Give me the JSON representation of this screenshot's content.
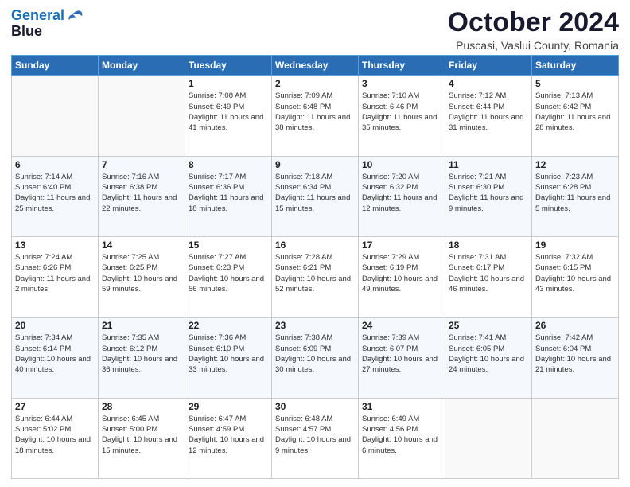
{
  "logo": {
    "line1": "General",
    "line2": "Blue"
  },
  "header": {
    "month": "October 2024",
    "location": "Puscasi, Vaslui County, Romania"
  },
  "days_of_week": [
    "Sunday",
    "Monday",
    "Tuesday",
    "Wednesday",
    "Thursday",
    "Friday",
    "Saturday"
  ],
  "weeks": [
    [
      {
        "day": "",
        "sunrise": "",
        "sunset": "",
        "daylight": ""
      },
      {
        "day": "",
        "sunrise": "",
        "sunset": "",
        "daylight": ""
      },
      {
        "day": "1",
        "sunrise": "Sunrise: 7:08 AM",
        "sunset": "Sunset: 6:49 PM",
        "daylight": "Daylight: 11 hours and 41 minutes."
      },
      {
        "day": "2",
        "sunrise": "Sunrise: 7:09 AM",
        "sunset": "Sunset: 6:48 PM",
        "daylight": "Daylight: 11 hours and 38 minutes."
      },
      {
        "day": "3",
        "sunrise": "Sunrise: 7:10 AM",
        "sunset": "Sunset: 6:46 PM",
        "daylight": "Daylight: 11 hours and 35 minutes."
      },
      {
        "day": "4",
        "sunrise": "Sunrise: 7:12 AM",
        "sunset": "Sunset: 6:44 PM",
        "daylight": "Daylight: 11 hours and 31 minutes."
      },
      {
        "day": "5",
        "sunrise": "Sunrise: 7:13 AM",
        "sunset": "Sunset: 6:42 PM",
        "daylight": "Daylight: 11 hours and 28 minutes."
      }
    ],
    [
      {
        "day": "6",
        "sunrise": "Sunrise: 7:14 AM",
        "sunset": "Sunset: 6:40 PM",
        "daylight": "Daylight: 11 hours and 25 minutes."
      },
      {
        "day": "7",
        "sunrise": "Sunrise: 7:16 AM",
        "sunset": "Sunset: 6:38 PM",
        "daylight": "Daylight: 11 hours and 22 minutes."
      },
      {
        "day": "8",
        "sunrise": "Sunrise: 7:17 AM",
        "sunset": "Sunset: 6:36 PM",
        "daylight": "Daylight: 11 hours and 18 minutes."
      },
      {
        "day": "9",
        "sunrise": "Sunrise: 7:18 AM",
        "sunset": "Sunset: 6:34 PM",
        "daylight": "Daylight: 11 hours and 15 minutes."
      },
      {
        "day": "10",
        "sunrise": "Sunrise: 7:20 AM",
        "sunset": "Sunset: 6:32 PM",
        "daylight": "Daylight: 11 hours and 12 minutes."
      },
      {
        "day": "11",
        "sunrise": "Sunrise: 7:21 AM",
        "sunset": "Sunset: 6:30 PM",
        "daylight": "Daylight: 11 hours and 9 minutes."
      },
      {
        "day": "12",
        "sunrise": "Sunrise: 7:23 AM",
        "sunset": "Sunset: 6:28 PM",
        "daylight": "Daylight: 11 hours and 5 minutes."
      }
    ],
    [
      {
        "day": "13",
        "sunrise": "Sunrise: 7:24 AM",
        "sunset": "Sunset: 6:26 PM",
        "daylight": "Daylight: 11 hours and 2 minutes."
      },
      {
        "day": "14",
        "sunrise": "Sunrise: 7:25 AM",
        "sunset": "Sunset: 6:25 PM",
        "daylight": "Daylight: 10 hours and 59 minutes."
      },
      {
        "day": "15",
        "sunrise": "Sunrise: 7:27 AM",
        "sunset": "Sunset: 6:23 PM",
        "daylight": "Daylight: 10 hours and 56 minutes."
      },
      {
        "day": "16",
        "sunrise": "Sunrise: 7:28 AM",
        "sunset": "Sunset: 6:21 PM",
        "daylight": "Daylight: 10 hours and 52 minutes."
      },
      {
        "day": "17",
        "sunrise": "Sunrise: 7:29 AM",
        "sunset": "Sunset: 6:19 PM",
        "daylight": "Daylight: 10 hours and 49 minutes."
      },
      {
        "day": "18",
        "sunrise": "Sunrise: 7:31 AM",
        "sunset": "Sunset: 6:17 PM",
        "daylight": "Daylight: 10 hours and 46 minutes."
      },
      {
        "day": "19",
        "sunrise": "Sunrise: 7:32 AM",
        "sunset": "Sunset: 6:15 PM",
        "daylight": "Daylight: 10 hours and 43 minutes."
      }
    ],
    [
      {
        "day": "20",
        "sunrise": "Sunrise: 7:34 AM",
        "sunset": "Sunset: 6:14 PM",
        "daylight": "Daylight: 10 hours and 40 minutes."
      },
      {
        "day": "21",
        "sunrise": "Sunrise: 7:35 AM",
        "sunset": "Sunset: 6:12 PM",
        "daylight": "Daylight: 10 hours and 36 minutes."
      },
      {
        "day": "22",
        "sunrise": "Sunrise: 7:36 AM",
        "sunset": "Sunset: 6:10 PM",
        "daylight": "Daylight: 10 hours and 33 minutes."
      },
      {
        "day": "23",
        "sunrise": "Sunrise: 7:38 AM",
        "sunset": "Sunset: 6:09 PM",
        "daylight": "Daylight: 10 hours and 30 minutes."
      },
      {
        "day": "24",
        "sunrise": "Sunrise: 7:39 AM",
        "sunset": "Sunset: 6:07 PM",
        "daylight": "Daylight: 10 hours and 27 minutes."
      },
      {
        "day": "25",
        "sunrise": "Sunrise: 7:41 AM",
        "sunset": "Sunset: 6:05 PM",
        "daylight": "Daylight: 10 hours and 24 minutes."
      },
      {
        "day": "26",
        "sunrise": "Sunrise: 7:42 AM",
        "sunset": "Sunset: 6:04 PM",
        "daylight": "Daylight: 10 hours and 21 minutes."
      }
    ],
    [
      {
        "day": "27",
        "sunrise": "Sunrise: 6:44 AM",
        "sunset": "Sunset: 5:02 PM",
        "daylight": "Daylight: 10 hours and 18 minutes."
      },
      {
        "day": "28",
        "sunrise": "Sunrise: 6:45 AM",
        "sunset": "Sunset: 5:00 PM",
        "daylight": "Daylight: 10 hours and 15 minutes."
      },
      {
        "day": "29",
        "sunrise": "Sunrise: 6:47 AM",
        "sunset": "Sunset: 4:59 PM",
        "daylight": "Daylight: 10 hours and 12 minutes."
      },
      {
        "day": "30",
        "sunrise": "Sunrise: 6:48 AM",
        "sunset": "Sunset: 4:57 PM",
        "daylight": "Daylight: 10 hours and 9 minutes."
      },
      {
        "day": "31",
        "sunrise": "Sunrise: 6:49 AM",
        "sunset": "Sunset: 4:56 PM",
        "daylight": "Daylight: 10 hours and 6 minutes."
      },
      {
        "day": "",
        "sunrise": "",
        "sunset": "",
        "daylight": ""
      },
      {
        "day": "",
        "sunrise": "",
        "sunset": "",
        "daylight": ""
      }
    ]
  ]
}
